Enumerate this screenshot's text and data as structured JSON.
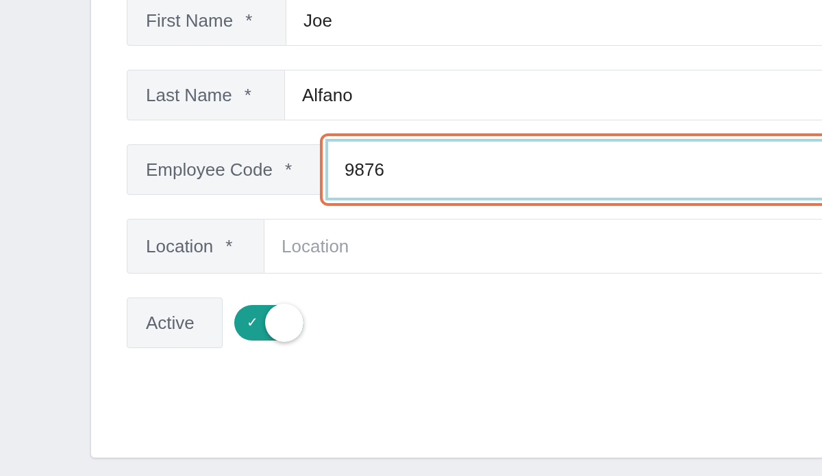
{
  "fields": [
    {
      "label": "First Name",
      "required_mark": "*",
      "value": "Joe",
      "focused": false
    },
    {
      "label": "Last Name",
      "required_mark": "*",
      "value": "Alfano",
      "focused": false
    },
    {
      "label": "Employee Code",
      "required_mark": "*",
      "value": "9876",
      "focused": true
    },
    {
      "label": "Location",
      "required_mark": "*",
      "placeholder": "Location",
      "focused": false
    }
  ],
  "active_toggle": {
    "label": "Active",
    "on": true,
    "check": "✓"
  }
}
